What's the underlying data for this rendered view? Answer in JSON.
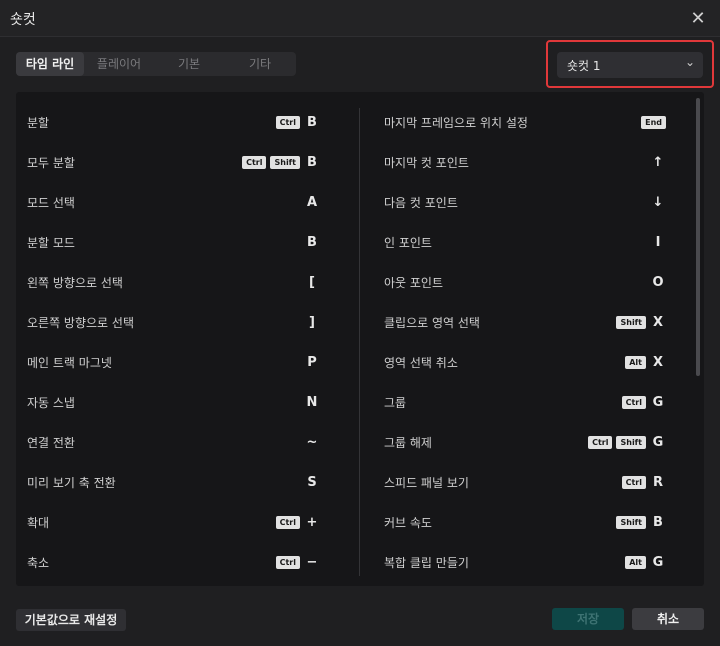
{
  "window": {
    "title": "숏컷",
    "close_icon": "close-icon"
  },
  "tabs": [
    {
      "label": "타임 라인",
      "active": true
    },
    {
      "label": "플레이어",
      "active": false
    },
    {
      "label": "기본",
      "active": false
    },
    {
      "label": "기타",
      "active": false
    }
  ],
  "preset": {
    "value": "숏컷 1",
    "chevron": "⌄"
  },
  "left_shortcuts": [
    {
      "label": "분할",
      "mods": [
        "Ctrl"
      ],
      "key": "B"
    },
    {
      "label": "모두 분할",
      "mods": [
        "Ctrl",
        "Shift"
      ],
      "key": "B"
    },
    {
      "label": "모드 선택",
      "mods": [],
      "key": "A"
    },
    {
      "label": "분할 모드",
      "mods": [],
      "key": "B"
    },
    {
      "label": "왼쪽 방향으로 선택",
      "mods": [],
      "key": "["
    },
    {
      "label": "오른쪽 방향으로 선택",
      "mods": [],
      "key": "]"
    },
    {
      "label": "메인 트랙 마그넷",
      "mods": [],
      "key": "P"
    },
    {
      "label": "자동 스냅",
      "mods": [],
      "key": "N"
    },
    {
      "label": "연결 전환",
      "mods": [],
      "key": "~"
    },
    {
      "label": "미리 보기 축 전환",
      "mods": [],
      "key": "S"
    },
    {
      "label": "확대",
      "mods": [
        "Ctrl"
      ],
      "key": "+"
    },
    {
      "label": "축소",
      "mods": [
        "Ctrl"
      ],
      "key": "−"
    }
  ],
  "right_shortcuts": [
    {
      "label": "마지막 프레임으로 위치 설정",
      "mods": [
        "End"
      ],
      "key": ""
    },
    {
      "label": "마지막 컷 포인트",
      "mods": [],
      "key": "↑"
    },
    {
      "label": "다음 컷 포인트",
      "mods": [],
      "key": "↓"
    },
    {
      "label": "인 포인트",
      "mods": [],
      "key": "I"
    },
    {
      "label": "아웃 포인트",
      "mods": [],
      "key": "O"
    },
    {
      "label": "클립으로 영역 선택",
      "mods": [
        "Shift"
      ],
      "key": "X"
    },
    {
      "label": "영역 선택 취소",
      "mods": [
        "Alt"
      ],
      "key": "X"
    },
    {
      "label": "그룹",
      "mods": [
        "Ctrl"
      ],
      "key": "G"
    },
    {
      "label": "그룹 해제",
      "mods": [
        "Ctrl",
        "Shift"
      ],
      "key": "G"
    },
    {
      "label": "스피드 패널 보기",
      "mods": [
        "Ctrl"
      ],
      "key": "R"
    },
    {
      "label": "커브 속도",
      "mods": [
        "Shift"
      ],
      "key": "B"
    },
    {
      "label": "복합 클립 만들기",
      "mods": [
        "Alt"
      ],
      "key": "G"
    }
  ],
  "footer": {
    "reset_label": "기본값으로 재설정",
    "save_label": "저장",
    "cancel_label": "취소"
  },
  "colors": {
    "accent_border": "#e0383a",
    "save_bg": "#0e4747"
  }
}
